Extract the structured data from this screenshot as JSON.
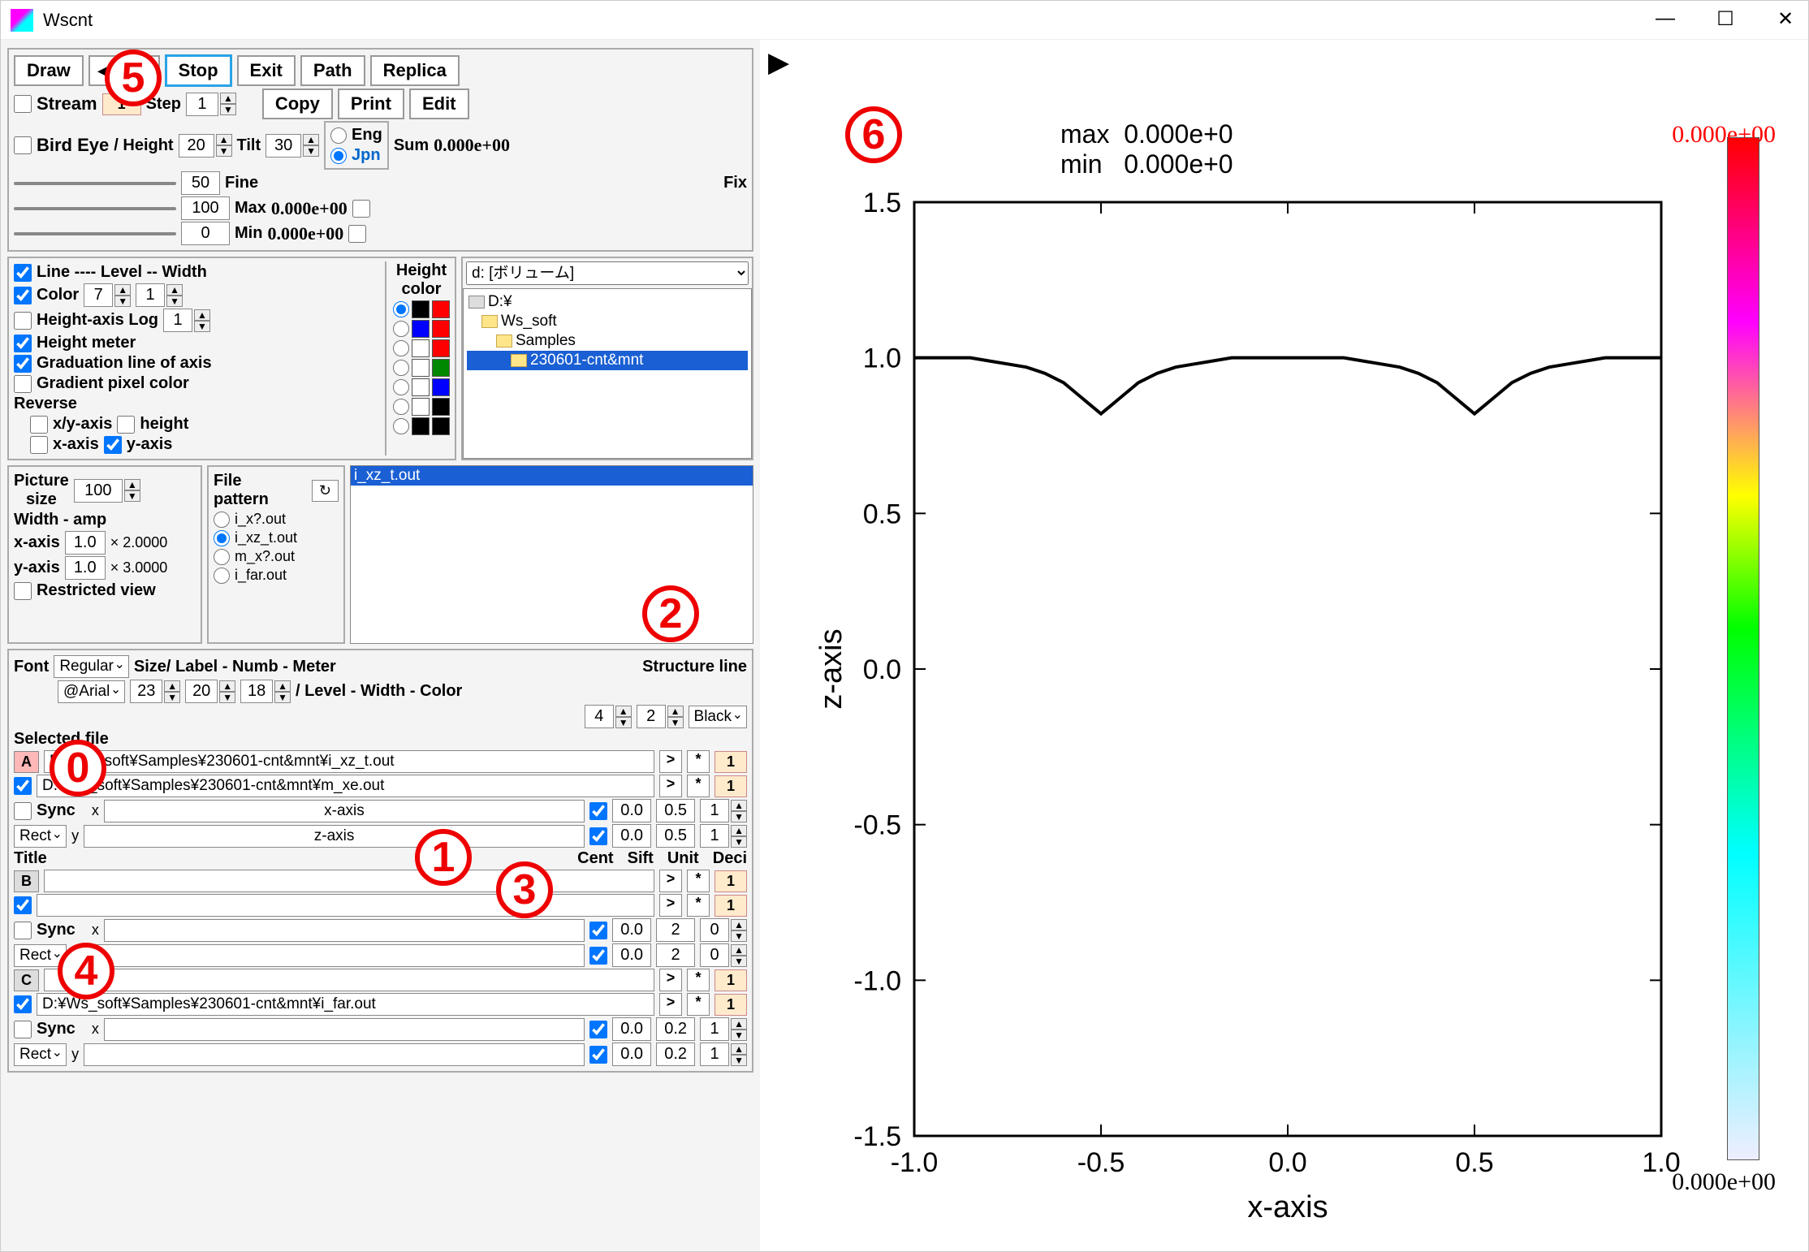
{
  "window": {
    "title": "Wscnt"
  },
  "toolbar": {
    "draw": "Draw",
    "stop": "Stop",
    "exit": "Exit",
    "path": "Path",
    "replica": "Replica",
    "stream": "Stream",
    "stream_val": "1",
    "step": "Step",
    "step_val": "1",
    "copy": "Copy",
    "print": "Print",
    "edit": "Edit",
    "birdeye": "Bird Eye",
    "height": "/ Height",
    "height_val": "20",
    "tilt": "Tilt",
    "tilt_val": "30",
    "fine": "Fine",
    "fine_val": "50",
    "eng": "Eng",
    "jpn": "Jpn",
    "sum": "Sum",
    "sum_val": "0.000e+00",
    "fix": "Fix",
    "max": "Max",
    "max_val": "0.000e+00",
    "max_in": "100",
    "min": "Min",
    "min_val": "0.000e+00",
    "min_in": "0"
  },
  "lineopts": {
    "line": "Line ---- Level -- Width",
    "color": "Color",
    "c1": "7",
    "c2": "1",
    "hlog": "Height-axis Log",
    "hlog_v": "1",
    "hmeter": "Height meter",
    "grad": "Graduation line of axis",
    "gpix": "Gradient pixel color",
    "reverse": "Reverse",
    "xyaxis": "x/y-axis",
    "height": "height",
    "xaxis": "x-axis",
    "yaxis": "y-axis",
    "hcolor": "Height\ncolor"
  },
  "picsize": {
    "title": "Picture\nsize",
    "val": "100",
    "wamp": "Width - amp",
    "xaxis": "x-axis",
    "xv": "1.0",
    "xmul": "× 2.0000",
    "yaxis": "y-axis",
    "yv": "1.0",
    "ymul": "× 3.0000",
    "restrict": "Restricted view"
  },
  "filepat": {
    "title": "File\npattern",
    "p1": "i_x?.out",
    "p2": "i_xz_t.out",
    "p3": "m_x?.out",
    "p4": "i_far.out"
  },
  "drive": {
    "sel": "d: [ボリューム]",
    "t1": "D:¥",
    "t2": "Ws_soft",
    "t3": "Samples",
    "t4": "230601-cnt&mnt"
  },
  "filelist": {
    "f1": "i_xz_t.out"
  },
  "fontsec": {
    "font": "Font",
    "fstyle": "Regular",
    "fname": "@Arial",
    "sizelabel": "Size/ Label - Numb - Meter",
    "s1": "23",
    "s2": "20",
    "s3": "18",
    "struct": "Structure line",
    "struct2": "/ Level - Width - Color",
    "lv": "4",
    "wv": "2",
    "cv": "Black"
  },
  "selfile": {
    "title": "Selected file",
    "A": "A",
    "a1": "D:¥Ws_soft¥Samples¥230601-cnt&mnt¥i_xz_t.out",
    "a2": "D:¥Ws_soft¥Samples¥230601-cnt&mnt¥m_xe.out",
    "sync": "Sync",
    "rect": "Rect",
    "x": "x",
    "xlab": "x-axis",
    "x0": "0.0",
    "x1": "0.5",
    "x2": "1",
    "y": "y",
    "ylab": "z-axis",
    "y0": "0.0",
    "y1": "0.5",
    "y2": "1",
    "title2": "Title",
    "cent": "Cent",
    "sift": "Sift",
    "unit": "Unit",
    "deci": "Deci",
    "B": "B",
    "bx0": "0.0",
    "bx1": "2",
    "bx2": "0",
    "by0": "0.0",
    "by1": "2",
    "by2": "0",
    "C": "C",
    "c1": "D:¥Ws_soft¥Samples¥230601-cnt&mnt¥i_far.out",
    "cx0": "0.0",
    "cx1": "0.2",
    "cx2": "1",
    "cy0": "0.0",
    "cy1": "0.2",
    "cy2": "1",
    "one": "1"
  },
  "plot": {
    "maxlbl": "max",
    "maxval": "0.000e+0",
    "minlbl": "min",
    "minval": "0.000e+0",
    "ylabel": "z-axis",
    "xlabel": "x-axis",
    "cb_top": "0.000e+00",
    "cb_bot": "0.000e+00"
  },
  "chart_data": {
    "type": "line",
    "title": "",
    "xlabel": "x-axis",
    "ylabel": "z-axis",
    "xlim": [
      -1.0,
      1.0
    ],
    "ylim": [
      -1.5,
      1.5
    ],
    "xticks": [
      -1.0,
      -0.5,
      0.0,
      0.5,
      1.0
    ],
    "yticks": [
      -1.5,
      -1.0,
      -0.5,
      0.0,
      0.5,
      1.0,
      1.5
    ],
    "series": [
      {
        "name": "i_xz_t.out",
        "x": [
          -1.0,
          -0.95,
          -0.9,
          -0.85,
          -0.8,
          -0.75,
          -0.7,
          -0.65,
          -0.6,
          -0.58,
          -0.55,
          -0.53,
          -0.51,
          -0.5,
          -0.49,
          -0.47,
          -0.45,
          -0.42,
          -0.4,
          -0.35,
          -0.3,
          -0.25,
          -0.2,
          -0.15,
          -0.1,
          -0.05,
          0.0,
          0.05,
          0.1,
          0.15,
          0.2,
          0.25,
          0.3,
          0.35,
          0.4,
          0.42,
          0.45,
          0.47,
          0.49,
          0.5,
          0.51,
          0.53,
          0.55,
          0.58,
          0.6,
          0.65,
          0.7,
          0.75,
          0.8,
          0.85,
          0.9,
          0.95,
          1.0
        ],
        "y": [
          1.0,
          1.0,
          1.0,
          1.0,
          0.99,
          0.98,
          0.97,
          0.95,
          0.92,
          0.9,
          0.87,
          0.85,
          0.83,
          0.82,
          0.83,
          0.85,
          0.87,
          0.9,
          0.92,
          0.95,
          0.97,
          0.98,
          0.99,
          1.0,
          1.0,
          1.0,
          1.0,
          1.0,
          1.0,
          1.0,
          0.99,
          0.98,
          0.97,
          0.95,
          0.92,
          0.9,
          0.87,
          0.85,
          0.83,
          0.82,
          0.83,
          0.85,
          0.87,
          0.9,
          0.92,
          0.95,
          0.97,
          0.98,
          0.99,
          1.0,
          1.0,
          1.0,
          1.0
        ]
      }
    ],
    "colorbar": {
      "min": 0.0,
      "max": 0.0,
      "label_top": "0.000e+00",
      "label_bot": "0.000e+00"
    },
    "stats": {
      "max": 0.0,
      "min": 0.0
    }
  },
  "annotations": [
    "0",
    "1",
    "2",
    "3",
    "4",
    "5",
    "6"
  ]
}
